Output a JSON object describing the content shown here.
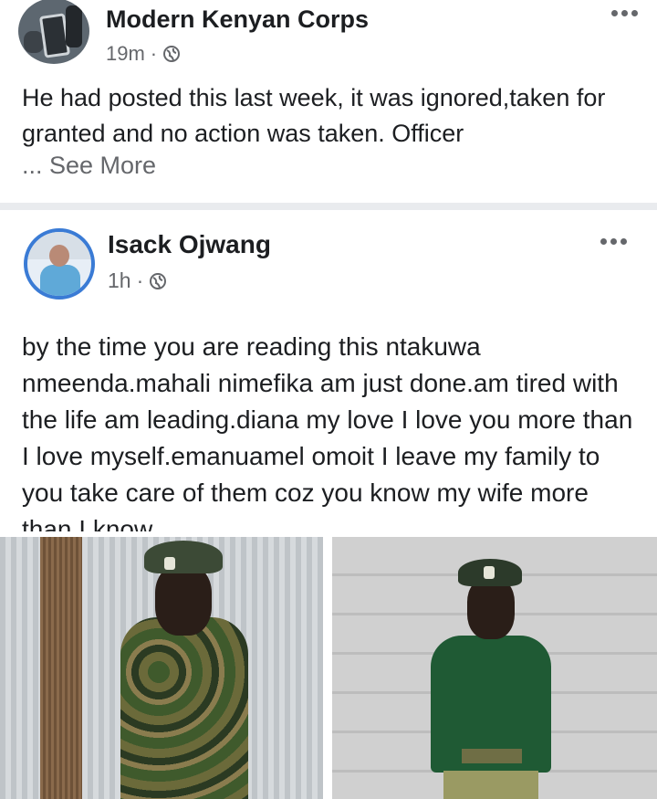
{
  "outer_post": {
    "author": "Modern Kenyan Corps",
    "time": "19m",
    "separator": "·",
    "text": "He had posted this last week, it was ignored,taken for granted and no action was taken. Officer",
    "see_more": "... See More"
  },
  "shared_post": {
    "author": "Isack Ojwang",
    "time": "1h",
    "separator": "·",
    "text": "by the time you are reading this ntakuwa nmeenda.mahali nimefika am just done.am tired with the life am leading.diana my love I love you more than I love myself.emanuamel omoit I leave my family to you take care of them coz you know my wife more than I know"
  },
  "icons": {
    "privacy": "globe-icon",
    "menu": "more-options-icon"
  },
  "colors": {
    "text": "#1c1e21",
    "meta": "#65676b",
    "avatar_ring": "#3a7bd5",
    "divider": "#e9ebee"
  },
  "photos": [
    {
      "subject": "officer-camouflage-uniform"
    },
    {
      "subject": "officer-green-sweater-uniform"
    }
  ]
}
